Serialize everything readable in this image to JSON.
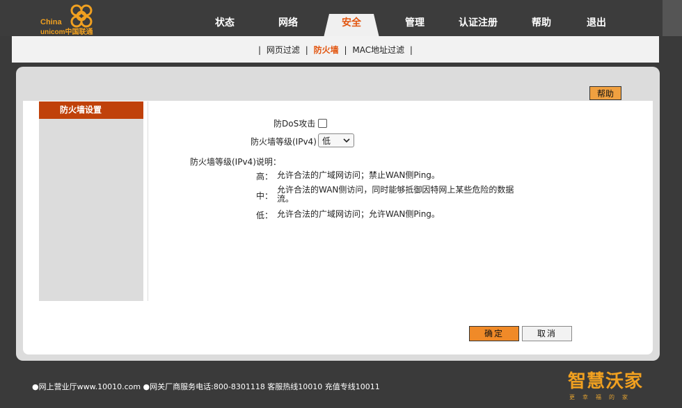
{
  "header": {
    "logo": {
      "line1": "China",
      "line2": "unicom中国联通"
    },
    "nav": [
      {
        "label": "状态"
      },
      {
        "label": "网络"
      },
      {
        "label": "安全"
      },
      {
        "label": "管理"
      },
      {
        "label": "认证注册"
      },
      {
        "label": "帮助"
      },
      {
        "label": "退出"
      }
    ],
    "active_nav": "安全"
  },
  "subnav": {
    "sep": "|",
    "items": [
      {
        "label": "网页过滤"
      },
      {
        "label": "防火墙"
      },
      {
        "label": "MAC地址过滤"
      }
    ],
    "active": "防火墙"
  },
  "help_button": "帮助",
  "sidebar": {
    "title": "防火墙设置"
  },
  "form": {
    "dos_label": "防DoS攻击",
    "dos_checked": false,
    "level_label": "防火墙等级(IPv4)",
    "level_value": "低",
    "desc_title": "防火墙等级(IPv4)说明：",
    "levels": [
      {
        "key": "高：",
        "text": "允许合法的广域网访问；禁止WAN侧Ping。"
      },
      {
        "key": "中：",
        "text": "允许合法的WAN侧访问，同时能够抵御因特网上某些危险的数据流。"
      },
      {
        "key": "低：",
        "text": "允许合法的广域网访问；允许WAN侧Ping。"
      }
    ]
  },
  "buttons": {
    "ok": "确定",
    "cancel": "取消"
  },
  "footer": {
    "text": "●网上营业厅www.10010.com ●网关厂商服务电话:800-8301118 客服热线10010 充值专线10011",
    "brand": "智慧沃家",
    "brand_sub": "更幸福的家"
  },
  "colors": {
    "accent": "#e2550f",
    "sidebar_head": "#c0410a",
    "ok_button": "#f08a28",
    "logo": "#f0a020"
  }
}
